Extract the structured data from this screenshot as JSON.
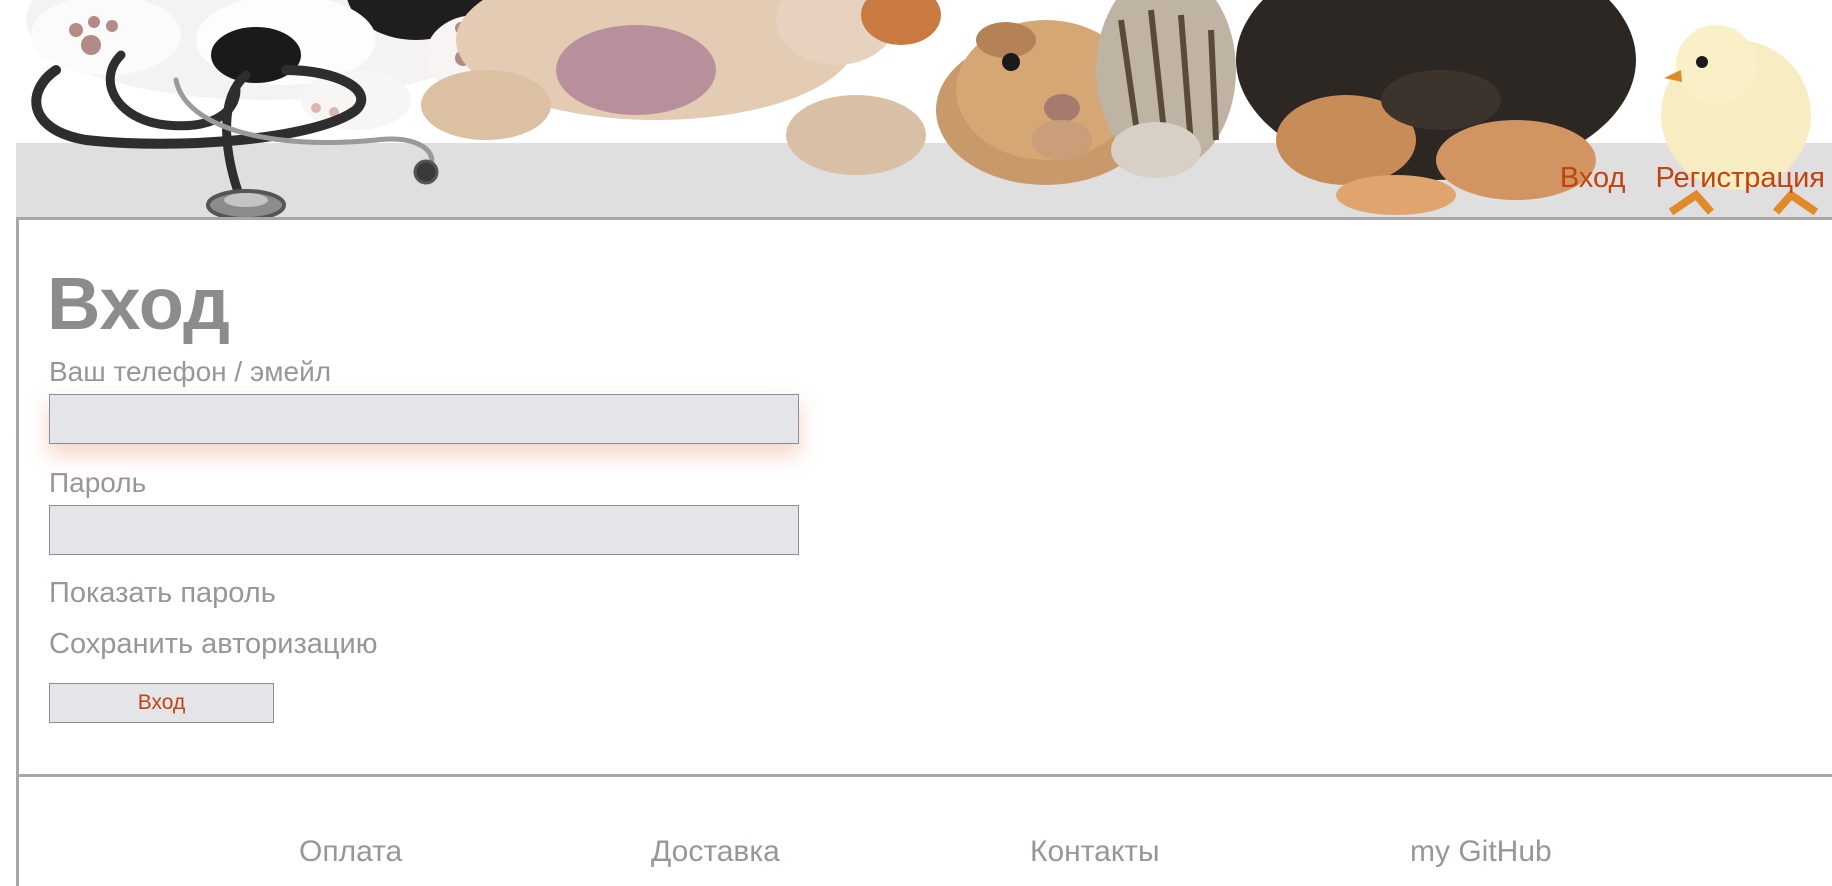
{
  "header": {
    "nav": {
      "login": "Вход",
      "register": "Регистрация"
    }
  },
  "login_form": {
    "title": "Вход",
    "login_label": "Ваш телефон / эмейл",
    "login_value": "",
    "password_label": "Пароль",
    "password_value": "",
    "show_password_label": "Показать пароль",
    "remember_label": "Сохранить авторизацию",
    "submit_label": "Вход"
  },
  "footer": {
    "links": {
      "payment": "Оплата",
      "delivery": "Доставка",
      "contacts": "Контакты",
      "github": "my GitHub"
    }
  },
  "colors": {
    "accent": "#c24210",
    "text": "#9a9697",
    "field_bg": "#e3e5e8",
    "border": "#a8a6a7"
  }
}
